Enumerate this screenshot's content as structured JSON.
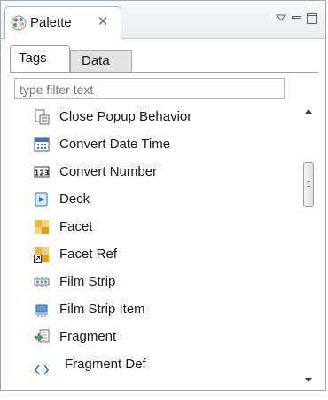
{
  "view": {
    "title": "Palette",
    "close_glyph": "✕",
    "icons": {
      "view": "palette-icon",
      "close": "close-icon",
      "menu": "view-menu-icon",
      "minimize": "minimize-icon",
      "maximize": "maximize-icon"
    }
  },
  "tabs": [
    {
      "label": "Tags",
      "selected": true
    },
    {
      "label": "Data",
      "selected": false
    }
  ],
  "filter": {
    "value": "",
    "placeholder": "type filter text"
  },
  "items": [
    {
      "label": "Close Popup Behavior",
      "icon": "close-popup-behavior-icon",
      "selected": false
    },
    {
      "label": "Convert Date Time",
      "icon": "convert-date-time-icon",
      "selected": true
    },
    {
      "label": "Convert Number",
      "icon": "convert-number-icon",
      "selected": false
    },
    {
      "label": "Deck",
      "icon": "deck-icon",
      "selected": false
    },
    {
      "label": "Facet",
      "icon": "facet-icon",
      "selected": false
    },
    {
      "label": "Facet Ref",
      "icon": "facet-ref-icon",
      "selected": false
    },
    {
      "label": "Film Strip",
      "icon": "film-strip-icon",
      "selected": false
    },
    {
      "label": "Film Strip Item",
      "icon": "film-strip-item-icon",
      "selected": false
    },
    {
      "label": "Fragment",
      "icon": "fragment-icon",
      "selected": false
    },
    {
      "label": "Fragment Def",
      "icon": "fragment-def-icon",
      "selected": false
    }
  ],
  "colors": {
    "selection": "#d3e4f8",
    "border": "#a0a8b4"
  }
}
